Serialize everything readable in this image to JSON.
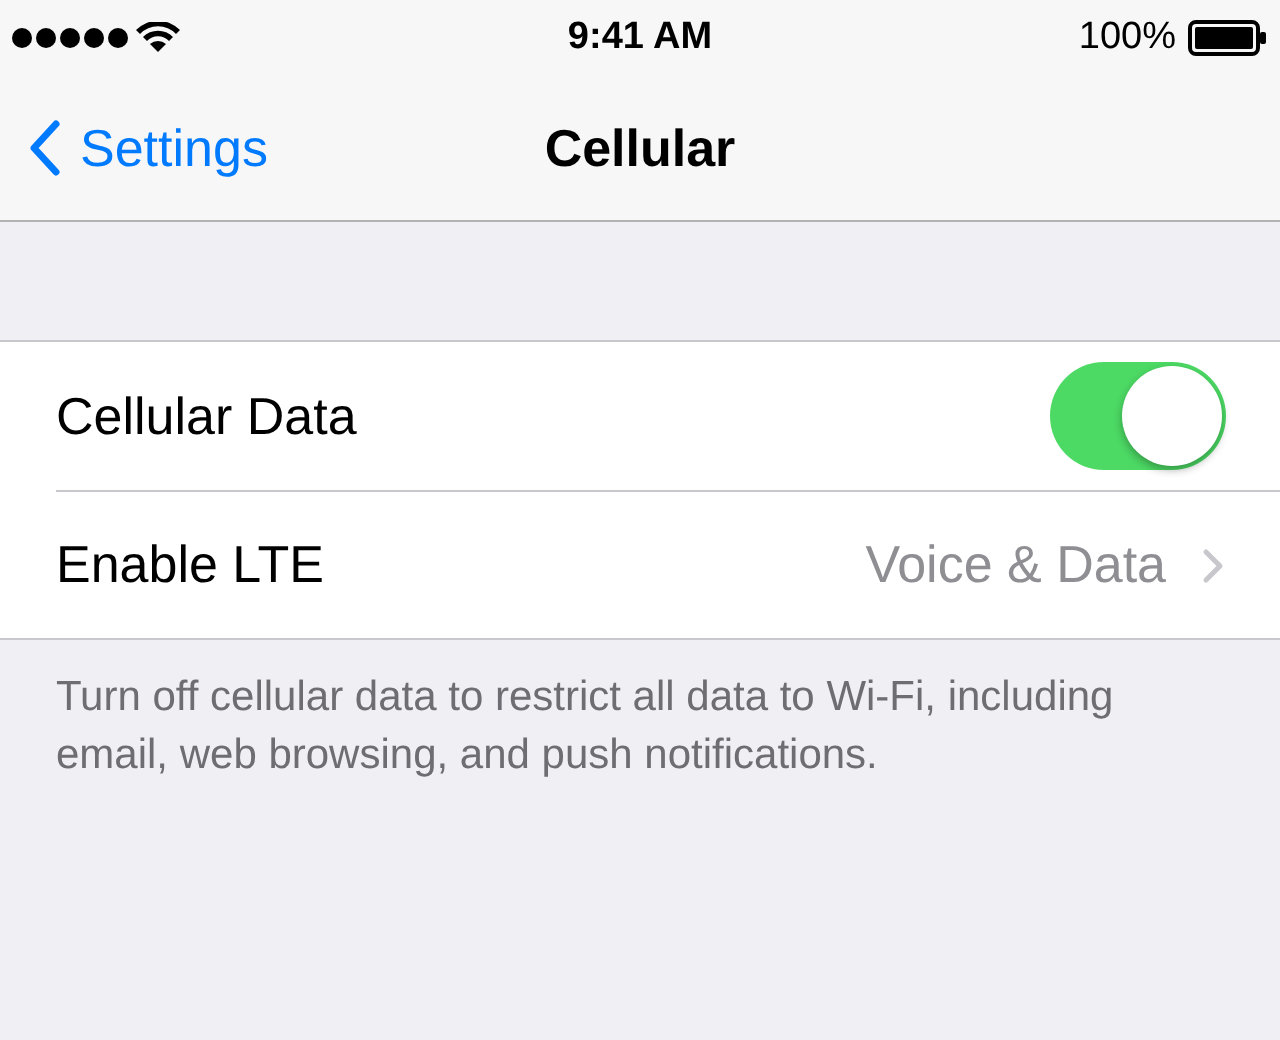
{
  "status_bar": {
    "time": "9:41 AM",
    "battery": "100%"
  },
  "nav_bar": {
    "back_label": "Settings",
    "title": "Cellular"
  },
  "rows": [
    {
      "kind": "toggle",
      "label": "Cellular Data",
      "on": true
    },
    {
      "kind": "disclosure",
      "label": "Enable LTE",
      "value": "Voice & Data"
    }
  ],
  "footer": "Turn off cellular data to restrict all data to Wi-Fi, including email, web browsing, and push notifications."
}
